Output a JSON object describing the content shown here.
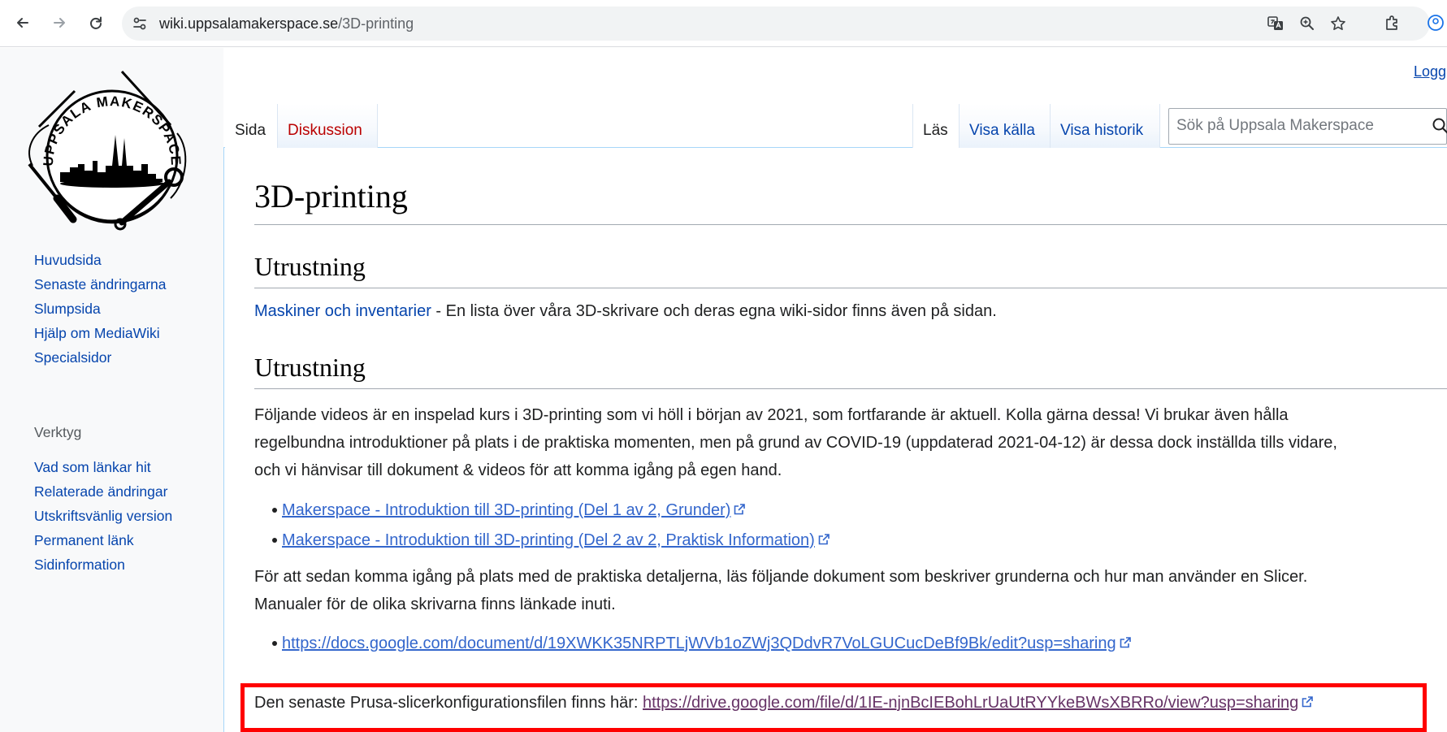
{
  "browser": {
    "url_domain": "wiki.uppsalamakerspace.se",
    "url_path": "/3D-printing"
  },
  "header": {
    "login_label": "Logg"
  },
  "tabs": {
    "left": [
      {
        "label": "Sida"
      },
      {
        "label": "Diskussion"
      }
    ],
    "right": [
      {
        "label": "Läs"
      },
      {
        "label": "Visa källa"
      },
      {
        "label": "Visa historik"
      }
    ]
  },
  "search": {
    "placeholder": "Sök på Uppsala Makerspace"
  },
  "logo": {
    "text": "UPPSALA MAKERSPACE"
  },
  "sidebar": {
    "nav": [
      {
        "label": "Huvudsida"
      },
      {
        "label": "Senaste ändringarna"
      },
      {
        "label": "Slumpsida"
      },
      {
        "label": "Hjälp om MediaWiki"
      },
      {
        "label": "Specialsidor"
      }
    ],
    "tools_heading": "Verktyg",
    "tools": [
      {
        "label": "Vad som länkar hit"
      },
      {
        "label": "Relaterade ändringar"
      },
      {
        "label": "Utskriftsvänlig version"
      },
      {
        "label": "Permanent länk"
      },
      {
        "label": "Sidinformation"
      }
    ]
  },
  "page": {
    "title": "3D-printing",
    "section1": {
      "heading": "Utrustning",
      "link": "Maskiner och inventarier",
      "text": " - En lista över våra 3D-skrivare och deras egna wiki-sidor finns även på sidan."
    },
    "section2": {
      "heading": "Utrustning",
      "intro_lines": [
        "Följande videos är en inspelad kurs i 3D-printing som vi höll i början av 2021, som fortfarande är aktuell. Kolla gärna dessa! Vi brukar även hålla",
        "regelbundna introduktioner på plats i de praktiska momenten, men på grund av COVID-19 (uppdaterad 2021-04-12) är dessa dock inställda tills vidare,",
        "och vi hänvisar till dokument & videos för att komma igång på egen hand."
      ],
      "videos": [
        {
          "label": "Makerspace - Introduktion till 3D-printing (Del 1 av 2, Grunder)"
        },
        {
          "label": "Makerspace - Introduktion till 3D-printing (Del 2 av 2, Praktisk Information)"
        }
      ],
      "docs_lines": [
        "För att sedan komma igång på plats med de praktiska detaljerna, läs följande dokument som beskriver grunderna och hur man använder en Slicer.",
        "Manualer för de olika skrivarna finns länkade inuti."
      ],
      "doc_link": "https://docs.google.com/document/d/19XWKK35NRPTLjWVb1oZWj3QDdvR7VoLGUCucDeBf9Bk/edit?usp=sharing",
      "config_text": "Den senaste Prusa-slicerkonfigurationsfilen finns här: ",
      "config_link": "https://drive.google.com/file/d/1IE-njnBcIEBohLrUaUtRYYkeBWsXBRRo/view?usp=sharing"
    }
  },
  "colors": {
    "link": "#0645ad",
    "external_link": "#3366cc",
    "visited_link": "#663366",
    "redlink": "#ba0000",
    "highlight_box": "#ff0000"
  }
}
